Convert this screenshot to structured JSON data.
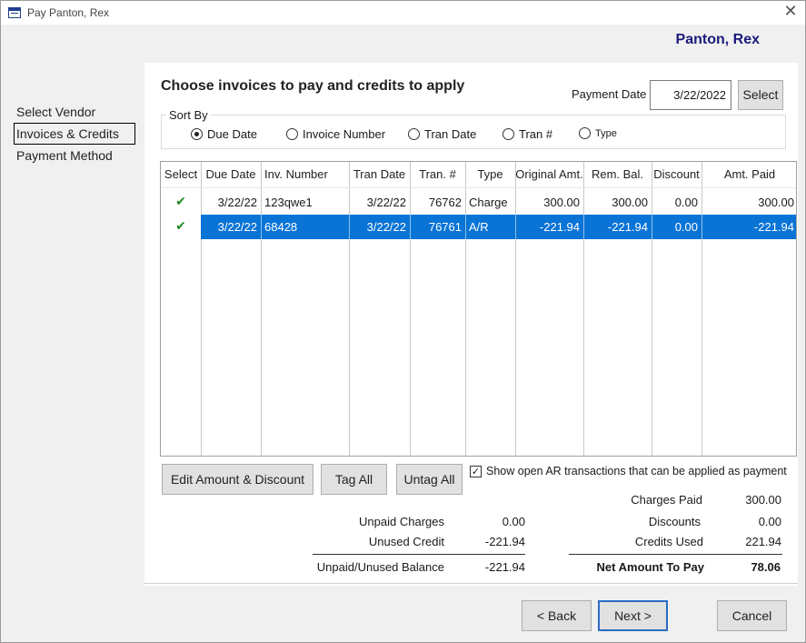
{
  "window": {
    "title": "Pay Panton, Rex",
    "close_glyph": "✕"
  },
  "customer_name": "Panton, Rex",
  "nav": {
    "items": [
      {
        "label": "Select Vendor",
        "active": false
      },
      {
        "label": "Invoices & Credits",
        "active": true
      },
      {
        "label": "Payment Method",
        "active": false
      }
    ]
  },
  "heading": "Choose invoices to pay and credits to apply",
  "payment_date": {
    "label": "Payment Date",
    "value": "3/22/2022",
    "select_label": "Select"
  },
  "sort_by": {
    "legend": "Sort By",
    "options": [
      {
        "label": "Due Date",
        "selected": true
      },
      {
        "label": "Invoice Number",
        "selected": false
      },
      {
        "label": "Tran Date",
        "selected": false
      },
      {
        "label": "Tran #",
        "selected": false
      },
      {
        "label": "Type",
        "selected": false
      }
    ]
  },
  "grid": {
    "columns": [
      "Select",
      "Due Date",
      "Inv. Number",
      "Tran Date",
      "Tran. #",
      "Type",
      "Original Amt.",
      "Rem. Bal.",
      "Discount",
      "Amt. Paid"
    ],
    "rows": [
      {
        "select": "✔",
        "due_date": "3/22/22",
        "inv_number": "123qwe1",
        "tran_date": "3/22/22",
        "tran_no": "76762",
        "type": "Charge",
        "original_amt": "300.00",
        "rem_bal": "300.00",
        "discount": "0.00",
        "amt_paid": "300.00",
        "selected": false
      },
      {
        "select": "✔",
        "due_date": "3/22/22",
        "inv_number": "68428",
        "tran_date": "3/22/22",
        "tran_no": "76761",
        "type": "A/R",
        "original_amt": "-221.94",
        "rem_bal": "-221.94",
        "discount": "0.00",
        "amt_paid": "-221.94",
        "selected": true
      }
    ]
  },
  "actions": {
    "edit_label": "Edit Amount & Discount",
    "tag_all_label": "Tag All",
    "untag_all_label": "Untag All",
    "show_open_label": "Show open AR transactions that can be applied as payment",
    "show_open_checked": true,
    "show_open_glyph": "✓"
  },
  "summary_left": {
    "unpaid_charges_label": "Unpaid Charges",
    "unpaid_charges": "0.00",
    "unused_credit_label": "Unused Credit",
    "unused_credit": "-221.94",
    "balance_label": "Unpaid/Unused Balance",
    "balance": "-221.94"
  },
  "summary_right": {
    "charges_paid_label": "Charges Paid",
    "charges_paid": "300.00",
    "discounts_label": "Discounts",
    "discounts": "0.00",
    "credits_used_label": "Credits Used",
    "credits_used": "221.94",
    "net_label": "Net Amount To Pay",
    "net": "78.06"
  },
  "footer": {
    "back_label": "< Back",
    "next_label": "Next >",
    "cancel_label": "Cancel"
  }
}
